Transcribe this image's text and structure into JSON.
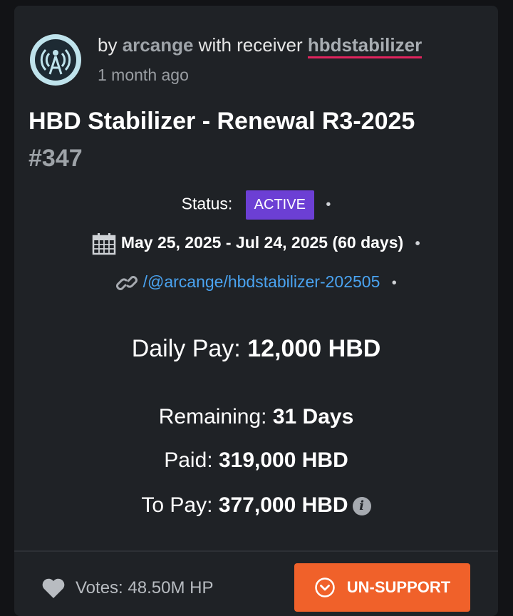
{
  "byline": {
    "prefix": "by",
    "author": "arcange",
    "middle": "with receiver",
    "receiver": "hbdstabilizer",
    "time_ago": "1 month ago"
  },
  "proposal": {
    "title": "HBD Stabilizer - Renewal R3-2025",
    "number": "#347"
  },
  "status": {
    "label": "Status:",
    "badge": "ACTIVE",
    "badge_color": "#6c3fd4"
  },
  "dates": {
    "icon": "calendar-icon",
    "range": "May 25, 2025 - Jul 24, 2025 (60 days)"
  },
  "permlink": {
    "icon": "link-icon",
    "text": "/@arcange/hbdstabilizer-202505"
  },
  "separator": "•",
  "daily_pay": {
    "label": "Daily Pay:",
    "value": "12,000 HBD"
  },
  "remaining": {
    "label": "Remaining:",
    "value": "31 Days"
  },
  "paid": {
    "label": "Paid:",
    "value": "319,000 HBD"
  },
  "to_pay": {
    "label": "To Pay:",
    "value": "377,000 HBD",
    "info_glyph": "i"
  },
  "footer": {
    "heart_icon": "heart-icon",
    "votes_label": "Votes:",
    "votes_value": "48.50M HP",
    "button_label": "UN-SUPPORT",
    "button_icon": "chevron-circle-icon",
    "button_color": "#f0612a"
  }
}
